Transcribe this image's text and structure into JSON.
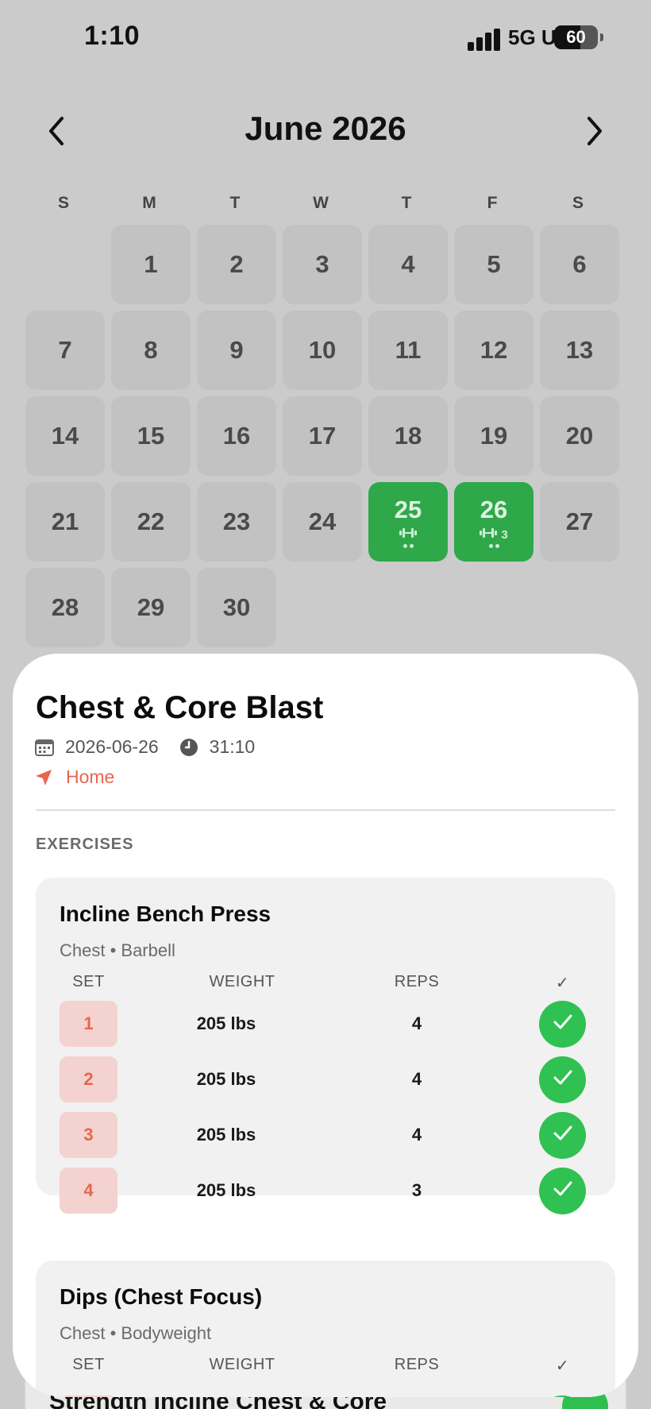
{
  "status": {
    "time": "1:10",
    "network": "5G UC",
    "battery": "60",
    "battery_level": 0.6
  },
  "calendar": {
    "month_title": "June 2026",
    "weekdays": [
      "S",
      "M",
      "T",
      "W",
      "T",
      "F",
      "S"
    ],
    "days": [
      {
        "n": "1"
      },
      {
        "n": "2"
      },
      {
        "n": "3"
      },
      {
        "n": "4"
      },
      {
        "n": "5"
      },
      {
        "n": "6"
      },
      {
        "n": "7"
      },
      {
        "n": "8"
      },
      {
        "n": "9"
      },
      {
        "n": "10"
      },
      {
        "n": "11"
      },
      {
        "n": "12"
      },
      {
        "n": "13"
      },
      {
        "n": "14"
      },
      {
        "n": "15"
      },
      {
        "n": "16"
      },
      {
        "n": "17"
      },
      {
        "n": "18"
      },
      {
        "n": "19"
      },
      {
        "n": "20"
      },
      {
        "n": "21"
      },
      {
        "n": "22"
      },
      {
        "n": "23"
      },
      {
        "n": "24"
      },
      {
        "n": "25",
        "active": true,
        "count": ""
      },
      {
        "n": "26",
        "active": true,
        "count": "3"
      },
      {
        "n": "27"
      },
      {
        "n": "28"
      },
      {
        "n": "29"
      },
      {
        "n": "30"
      }
    ],
    "active_color": "#2fa84a"
  },
  "workout": {
    "title": "Chest & Core Blast",
    "date": "2026-06-26",
    "duration": "31:10",
    "location": "Home",
    "section_label": "EXERCISES",
    "exercises": [
      {
        "name": "Incline Bench Press",
        "sub": "Chest • Barbell",
        "headers": {
          "set": "SET",
          "weight": "WEIGHT",
          "reps": "REPS",
          "check": "✓"
        },
        "sets": [
          {
            "set": "1",
            "weight": "205 lbs",
            "reps": "4"
          },
          {
            "set": "2",
            "weight": "205 lbs",
            "reps": "4"
          },
          {
            "set": "3",
            "weight": "205 lbs",
            "reps": "4"
          },
          {
            "set": "4",
            "weight": "205 lbs",
            "reps": "3"
          }
        ]
      },
      {
        "name": "Dips (Chest Focus)",
        "sub": "Chest • Bodyweight",
        "headers": {
          "set": "SET",
          "weight": "WEIGHT",
          "reps": "REPS",
          "check": "✓"
        },
        "sets": []
      }
    ]
  },
  "peek": {
    "title": "Strength Incline Chest & Core"
  }
}
